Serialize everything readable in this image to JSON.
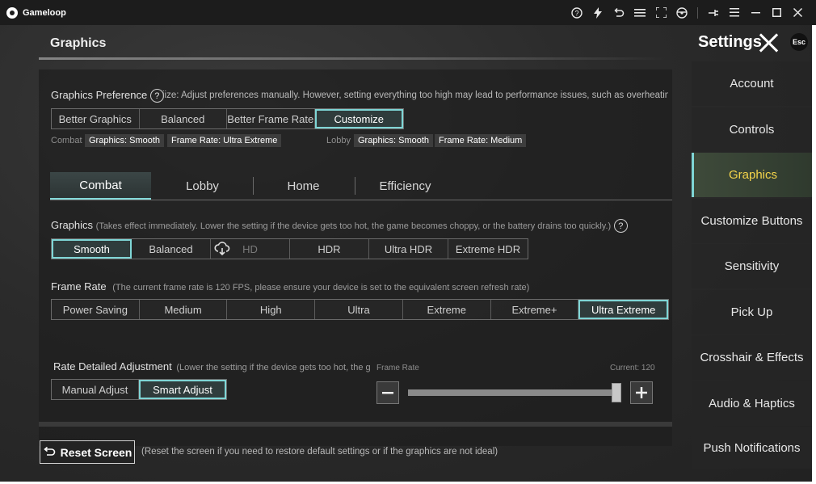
{
  "window": {
    "title": "Gameloop"
  },
  "header": {
    "title": "Graphics",
    "settings_title": "Settings",
    "esc_label": "Esc"
  },
  "preference": {
    "label": "Graphics Preference",
    "description": "iize: Adjust preferences manually. However, setting everything too high may lead to performance issues, such as overheating, batt",
    "options": [
      "Better Graphics",
      "Balanced",
      "Better Frame Rate",
      "Customize"
    ],
    "selected": "Customize",
    "combat_label": "Combat",
    "combat_graphics": "Graphics: Smooth",
    "combat_frame": "Frame Rate: Ultra Extreme",
    "lobby_label": "Lobby",
    "lobby_graphics": "Graphics: Smooth",
    "lobby_frame": "Frame Rate: Medium"
  },
  "tabs": [
    "Combat",
    "Lobby",
    "Home",
    "Efficiency"
  ],
  "active_tab": "Combat",
  "graphics": {
    "label": "Graphics",
    "description": "(Takes effect immediately. Lower the setting if the device gets too hot, the game becomes choppy, or the battery drains too quickly.)",
    "options": [
      "Smooth",
      "Balanced",
      "HD",
      "HDR",
      "Ultra HDR",
      "Extreme HDR"
    ],
    "selected": "Smooth"
  },
  "frame_rate": {
    "label": "Frame Rate",
    "description": "(The current frame rate is 120 FPS, please ensure your device is set to the equivalent screen refresh rate)",
    "options": [
      "Power Saving",
      "Medium",
      "High",
      "Ultra",
      "Extreme",
      "Extreme+",
      "Ultra Extreme"
    ],
    "selected": "Ultra Extreme"
  },
  "rate_adjust": {
    "label": "Rate Detailed Adjustment",
    "description": "(Lower the setting if the device gets too hot, the gam",
    "options": [
      "Manual Adjust",
      "Smart Adjust"
    ],
    "selected": "Smart Adjust",
    "slider_label": "Frame Rate",
    "current_label": "Current: 120",
    "slider_fraction": 0.98
  },
  "reset": {
    "button_label": "Reset Screen",
    "description": "(Reset the screen if you need to restore default settings or if the graphics are not ideal)"
  },
  "sidebar": {
    "items": [
      "Account",
      "Controls",
      "Graphics",
      "Customize Buttons",
      "Sensitivity",
      "Pick Up",
      "Crosshair & Effects",
      "Audio & Haptics",
      "Push Notifications"
    ],
    "active": "Graphics"
  },
  "colors": {
    "accent": "#7fd6d6",
    "active_sidebar_text": "#f3d34a"
  },
  "titlebar_icons": [
    "help-icon",
    "lightning-icon",
    "back-icon",
    "list-icon",
    "fullscreen-icon",
    "steering-icon",
    "pin-icon",
    "menu-icon",
    "minimize-icon",
    "maximize-icon",
    "close-icon"
  ]
}
